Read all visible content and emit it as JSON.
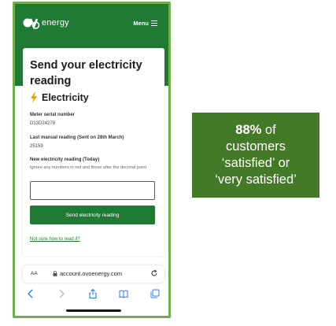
{
  "app": {
    "logo_text": "energy",
    "menu_label": "Menu"
  },
  "form": {
    "title": "Send your electricity reading",
    "section_title": "Electricity",
    "serial_label": "Meter serial number",
    "serial_value": "D13D24278",
    "last_reading_label": "Last manual reading (Sent on 28th March)",
    "last_reading_value": "25159",
    "new_reading_label": "New electricity reading (Today)",
    "new_reading_hint": "Ignore any numbers in red and those after the decimal point",
    "new_reading_value": "",
    "submit_label": "Send electricity reading",
    "help_link": "Not sure how to read it?"
  },
  "browser": {
    "aa_label": "AA",
    "url": "account.ovoenergy.com"
  },
  "stat": {
    "percent": "88%",
    "line1_rest": " of",
    "line2": "customers",
    "line3": "‘satisfied’ or",
    "line4": "‘very satisfied’"
  },
  "colors": {
    "brand_green": "#1f7a33",
    "stat_green": "#447a27",
    "frame_green": "#6fae4a",
    "bolt_orange": "#f39c12"
  },
  "icons": [
    "ovo-logo-icon",
    "menu-icon",
    "lightning-bolt-icon",
    "lock-icon",
    "reload-icon",
    "back-icon",
    "forward-icon",
    "share-icon",
    "bookmarks-icon",
    "tabs-icon"
  ]
}
